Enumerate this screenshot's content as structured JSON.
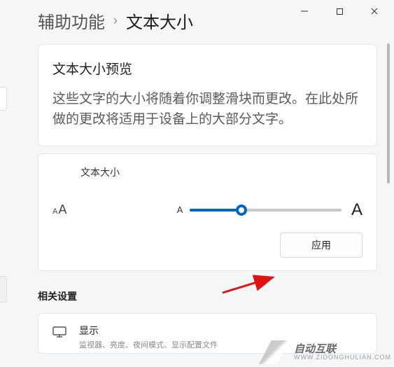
{
  "breadcrumb": {
    "parent": "辅助功能",
    "sep": "›",
    "current": "文本大小"
  },
  "preview": {
    "title": "文本大小预览",
    "body": "这些文字的大小将随着你调整滑块而更改。在此处所做的更改将适用于设备上的大部分文字。"
  },
  "textsize": {
    "label": "文本大小",
    "marker_small": "A",
    "marker_big": "A",
    "apply_label": "应用"
  },
  "related": {
    "heading": "相关设置",
    "display_title": "显示",
    "display_sub": "监视器、亮度、夜间模式、显示配置文件"
  },
  "watermark": {
    "main": "自动互联",
    "sub": "WWW.ZIDONGHULIAN.COM"
  },
  "colors": {
    "accent": "#0067c0",
    "arrow": "#e01212"
  },
  "slider": {
    "value_pct": 34
  }
}
